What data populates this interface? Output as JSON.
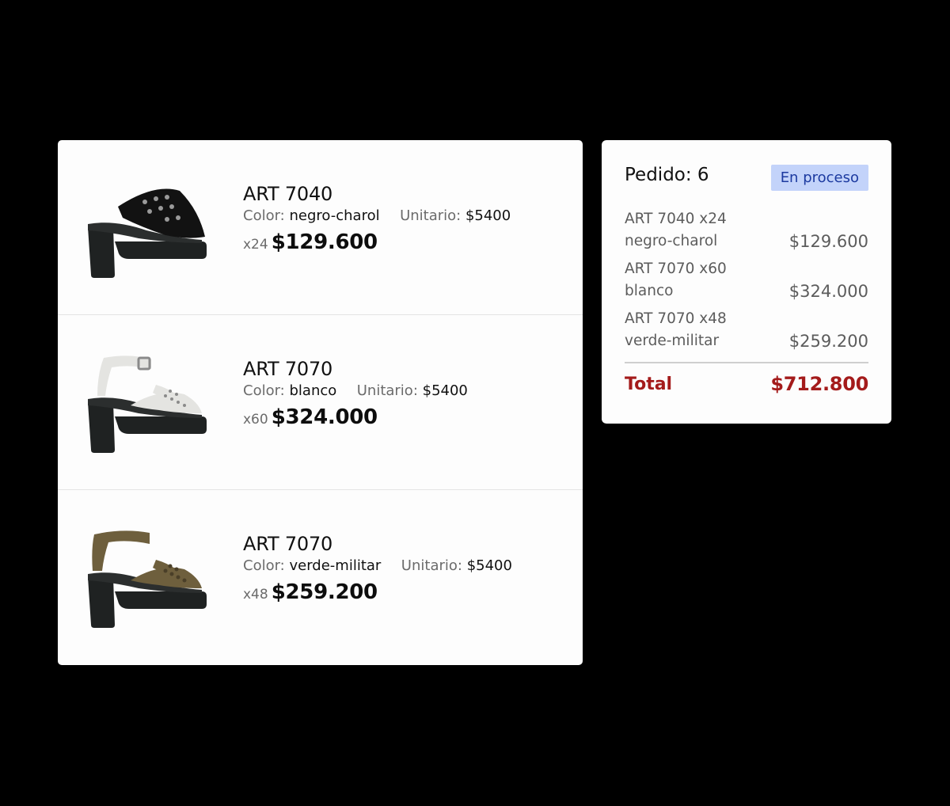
{
  "items": [
    {
      "title": "ART 7040",
      "color_label": "Color:",
      "color_value": "negro-charol",
      "unit_label": "Unitario:",
      "unit_value": "$5400",
      "qty": "x24",
      "price": "$129.600",
      "shoe_colors": {
        "upper": "#121212",
        "platform": "#1f2222",
        "accent": "#9a9a9a"
      }
    },
    {
      "title": "ART 7070",
      "color_label": "Color:",
      "color_value": "blanco",
      "unit_label": "Unitario:",
      "unit_value": "$5400",
      "qty": "x60",
      "price": "$324.000",
      "shoe_colors": {
        "upper": "#e4e4e1",
        "platform": "#1f2222",
        "accent": "#8a8a8a"
      }
    },
    {
      "title": "ART 7070",
      "color_label": "Color:",
      "color_value": "verde-militar",
      "unit_label": "Unitario:",
      "unit_value": "$5400",
      "qty": "x48",
      "price": "$259.200",
      "shoe_colors": {
        "upper": "#6e5f3d",
        "platform": "#1f2222",
        "accent": "#4a3f28"
      }
    }
  ],
  "summary": {
    "order_title": "Pedido: 6",
    "status": "En proceso",
    "lines": [
      {
        "desc_line1": "ART 7040 x24",
        "desc_line2": "negro-charol",
        "amount": "$129.600"
      },
      {
        "desc_line1": "ART 7070 x60",
        "desc_line2": "blanco",
        "amount": "$324.000"
      },
      {
        "desc_line1": "ART 7070 x48",
        "desc_line2": "verde-militar",
        "amount": "$259.200"
      }
    ],
    "total_label": "Total",
    "total_amount": "$712.800"
  },
  "colors": {
    "status_bg": "#c3d3fa",
    "status_text": "#1c3aa0",
    "total": "#a41b1b"
  }
}
